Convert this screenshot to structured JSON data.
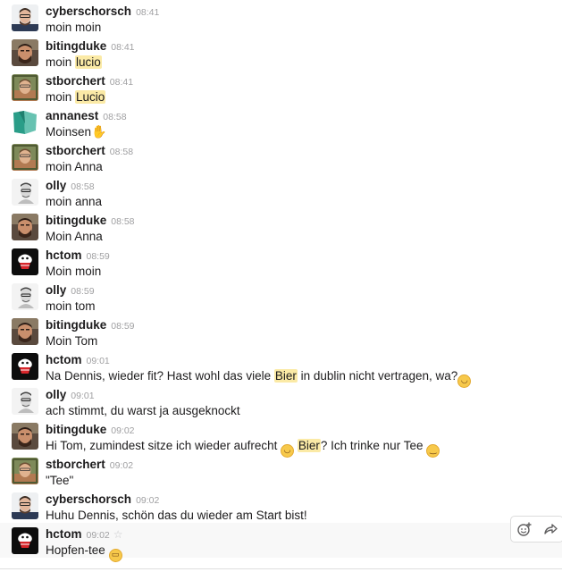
{
  "messages": [
    {
      "author": "cyberschorsch",
      "avatar": "cyber",
      "time": "08:41",
      "parts": [
        {
          "t": "moin moin"
        }
      ]
    },
    {
      "author": "bitingduke",
      "avatar": "duke",
      "time": "08:41",
      "parts": [
        {
          "t": "moin "
        },
        {
          "h": "lucio"
        }
      ]
    },
    {
      "author": "stborchert",
      "avatar": "stb",
      "time": "08:41",
      "parts": [
        {
          "t": "moin "
        },
        {
          "h": "Lucio"
        }
      ]
    },
    {
      "author": "annanest",
      "avatar": "anna",
      "time": "08:58",
      "parts": [
        {
          "t": "Moinsen"
        },
        {
          "e": "hand"
        }
      ]
    },
    {
      "author": "stborchert",
      "avatar": "stb",
      "time": "08:58",
      "parts": [
        {
          "t": "moin Anna"
        }
      ]
    },
    {
      "author": "olly",
      "avatar": "olly",
      "time": "08:58",
      "parts": [
        {
          "t": "moin anna"
        }
      ]
    },
    {
      "author": "bitingduke",
      "avatar": "duke",
      "time": "08:58",
      "parts": [
        {
          "t": "Moin Anna"
        }
      ]
    },
    {
      "author": "hctom",
      "avatar": "hctom",
      "time": "08:59",
      "parts": [
        {
          "t": "Moin moin"
        }
      ]
    },
    {
      "author": "olly",
      "avatar": "olly",
      "time": "08:59",
      "parts": [
        {
          "t": "moin tom"
        }
      ]
    },
    {
      "author": "bitingduke",
      "avatar": "duke",
      "time": "08:59",
      "parts": [
        {
          "t": "Moin Tom"
        }
      ]
    },
    {
      "author": "hctom",
      "avatar": "hctom",
      "time": "09:01",
      "parts": [
        {
          "t": "Na Dennis, wieder fit? Hast wohl das viele "
        },
        {
          "h": "Bier"
        },
        {
          "t": " in dublin nicht vertragen, wa?"
        },
        {
          "e": "blush"
        }
      ]
    },
    {
      "author": "olly",
      "avatar": "olly",
      "time": "09:01",
      "parts": [
        {
          "t": "ach stimmt, du warst ja ausgeknockt"
        }
      ]
    },
    {
      "author": "bitingduke",
      "avatar": "duke",
      "time": "09:02",
      "parts": [
        {
          "t": "Hi Tom, zumindest sitze ich wieder aufrecht "
        },
        {
          "e": "slight-smile"
        },
        {
          "t": " "
        },
        {
          "h": "Bier"
        },
        {
          "t": "? Ich trinke nur Tee "
        },
        {
          "e": "wink"
        }
      ]
    },
    {
      "author": "stborchert",
      "avatar": "stb",
      "time": "09:02",
      "parts": [
        {
          "t": "\"Tee\""
        }
      ]
    },
    {
      "author": "cyberschorsch",
      "avatar": "cyber",
      "time": "09:02",
      "parts": [
        {
          "t": "Huhu Dennis, schön das du wieder am Start bist!"
        }
      ]
    },
    {
      "author": "hctom",
      "avatar": "hctom",
      "time": "09:02",
      "star": true,
      "hover": true,
      "parts": [
        {
          "t": "Hopfen-tee "
        },
        {
          "e": "grin"
        }
      ]
    }
  ],
  "emoji_glyphs": {
    "blush": "◡",
    "slight-smile": "◡",
    "wink": "‿",
    "grin": "▭",
    "hand": "✋"
  },
  "message_actions": {
    "add_reaction": "add-reaction-icon",
    "share": "share-arrow-icon"
  },
  "colors": {
    "highlight": "#fbeaa6",
    "timestamp": "#a0a0a2",
    "hover_bg": "#f8f8f8"
  }
}
